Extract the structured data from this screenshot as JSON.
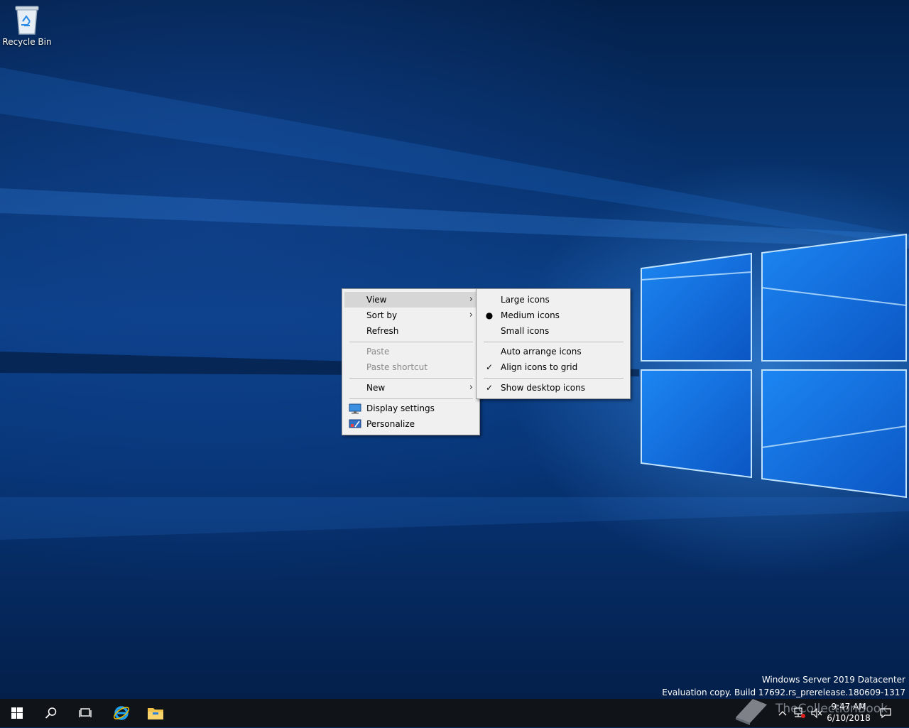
{
  "desktop": {
    "icons": [
      {
        "label": "Recycle Bin",
        "icon": "recycle-bin-icon"
      }
    ],
    "watermark": {
      "line1": "Windows Server 2019 Datacenter",
      "line2": "Evaluation copy. Build 17692.rs_prerelease.180609-1317"
    },
    "credit": "TheCollectionBook"
  },
  "context_menu": {
    "items": [
      {
        "label": "View",
        "submenu": true,
        "highlighted": true
      },
      {
        "label": "Sort by",
        "submenu": true
      },
      {
        "label": "Refresh"
      },
      {
        "label": "Paste",
        "disabled": true
      },
      {
        "label": "Paste shortcut",
        "disabled": true
      },
      {
        "label": "New",
        "submenu": true
      },
      {
        "label": "Display settings",
        "icon": "display-settings-icon"
      },
      {
        "label": "Personalize",
        "icon": "personalize-icon"
      }
    ]
  },
  "view_submenu": {
    "items": [
      {
        "label": "Large icons"
      },
      {
        "label": "Medium icons",
        "mark": "bullet"
      },
      {
        "label": "Small icons"
      },
      {
        "label": "Auto arrange icons"
      },
      {
        "label": "Align icons to grid",
        "mark": "check"
      },
      {
        "label": "Show desktop icons",
        "mark": "check"
      }
    ]
  },
  "taskbar": {
    "buttons": [
      "start-icon",
      "search-icon",
      "task-view-icon",
      "internet-explorer-icon",
      "file-explorer-icon"
    ],
    "tray": [
      "chevron-up-icon",
      "network-icon",
      "volume-icon",
      "notification-icon"
    ],
    "clock": {
      "time": "9:47 AM",
      "date": "6/10/2018"
    }
  },
  "colors": {
    "menu_bg": "#f0f0f0",
    "menu_highlight": "#d6d6d6",
    "taskbar_bg": "#101418",
    "wallpaper_accent": "#3ea0ff"
  }
}
